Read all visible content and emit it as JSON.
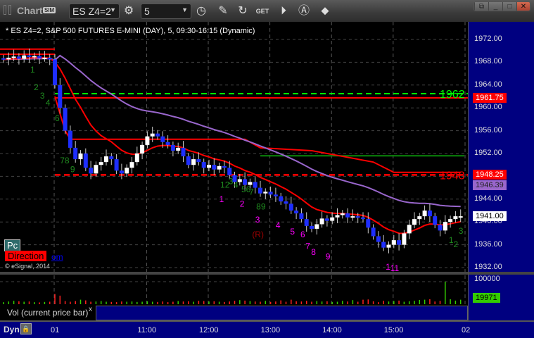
{
  "titlebar": {
    "title": "Chart",
    "sim_badge": "SIM",
    "symbol": "ES Z4=2",
    "interval": "5",
    "icons": [
      "settings-gear-icon",
      "clock-icon",
      "pencil-icon",
      "refresh-icon",
      "get-icon",
      "play-icon",
      "auto-scale-icon",
      "link-icon"
    ],
    "window_buttons": [
      "restore-dropdown",
      "minimize",
      "maximize",
      "close"
    ]
  },
  "chart_header": "* ES Z4=2, S&P 500 FUTURES E-MINI (DAY), 5, 09:30-16:15 (Dynamic)",
  "price_axis": {
    "ticks": [
      "1972.00",
      "1968.00",
      "1964.00",
      "1960.00",
      "1956.00",
      "1952.00",
      "1948.00",
      "1944.00",
      "1940.00",
      "1936.00",
      "1932.00"
    ],
    "tags": [
      {
        "text": "1961.75",
        "price": 1961.75,
        "bg": "#ff0000",
        "fg": "#ffffff"
      },
      {
        "text": "1948.25",
        "price": 1948.25,
        "bg": "#ff0000",
        "fg": "#ffffff"
      },
      {
        "text": "1946.39",
        "price": 1946.39,
        "bg": "#9966cc",
        "fg": "#222222"
      },
      {
        "text": "1941.00",
        "price": 1941.0,
        "bg": "#ffffff",
        "fg": "#000000"
      }
    ]
  },
  "levels": [
    {
      "label": "1962",
      "price": 1962.5,
      "color": "#00ff00",
      "dash": true
    },
    {
      "label": "1948",
      "price": 1948.25,
      "color": "#ff0000",
      "dash": true
    }
  ],
  "volume_axis": {
    "tick": "100000",
    "current": "19971",
    "label": "Vol (current price bar)",
    "close": "x"
  },
  "time_axis": {
    "mode": "Dyn",
    "ticks": [
      {
        "t": "01",
        "bar": 10
      },
      {
        "t": "11:00",
        "bar": 28
      },
      {
        "t": "12:00",
        "bar": 40
      },
      {
        "t": "13:00",
        "bar": 52
      },
      {
        "t": "14:00",
        "bar": 64
      },
      {
        "t": "15:00",
        "bar": 76
      },
      {
        "t": "02",
        "bar": 90
      }
    ]
  },
  "overlay": {
    "pc": "Pc",
    "direction": "Direction",
    "link": "om",
    "copyright": "© eSignal, 2014"
  },
  "chart_data": {
    "type": "candlestick",
    "ylim": [
      1932,
      1972
    ],
    "vol_max": 100000,
    "closes": [
      1968.5,
      1968.8,
      1969,
      1968.6,
      1969.2,
      1968.9,
      1969.1,
      1968.7,
      1968.8,
      1968.5,
      1964,
      1960,
      1956,
      1953,
      1951,
      1952,
      1949.5,
      1948.5,
      1950,
      1950.5,
      1951.5,
      1951,
      1949,
      1948.5,
      1949.5,
      1950.5,
      1952,
      1953.5,
      1955,
      1955.5,
      1955,
      1954,
      1953.5,
      1952.5,
      1953,
      1951.5,
      1950,
      1951,
      1950.5,
      1949.5,
      1950,
      1949.2,
      1949.8,
      1949.5,
      1948.2,
      1947,
      1947.5,
      1946.5,
      1947,
      1946,
      1945,
      1945.3,
      1944.8,
      1944.5,
      1943.6,
      1943.2,
      1942,
      1941.5,
      1940.5,
      1939.3,
      1938.8,
      1939.6,
      1940.6,
      1940.2,
      1940.8,
      1941.2,
      1941.5,
      1940.8,
      1941,
      1940.8,
      1940.5,
      1939,
      1937.5,
      1936.5,
      1935.5,
      1936,
      1936.8,
      1936,
      1938,
      1939.5,
      1940.5,
      1941,
      1942,
      1941,
      1939.5,
      1938.5,
      1940,
      1940.5,
      1941,
      1941
    ],
    "volumes": [
      9000,
      12000,
      15000,
      13000,
      11000,
      12000,
      9000,
      8000,
      10000,
      11000,
      45000,
      38000,
      14000,
      11000,
      14000,
      20000,
      17000,
      11000,
      12000,
      14000,
      11000,
      10000,
      9000,
      12000,
      11000,
      12000,
      10000,
      11000,
      13000,
      11000,
      10000,
      12000,
      9000,
      11000,
      14000,
      12000,
      13000,
      11000,
      15000,
      14000,
      12000,
      13000,
      11000,
      10000,
      12000,
      15000,
      18000,
      16000,
      14000,
      12000,
      11000,
      15000,
      10000,
      12000,
      17000,
      11000,
      20000,
      13000,
      12000,
      15000,
      11000,
      14000,
      12000,
      13000,
      10000,
      11000,
      15000,
      12000,
      18000,
      11000,
      20000,
      21000,
      13000,
      9000,
      15000,
      12000,
      14000,
      16000,
      11000,
      13000,
      15000,
      19000,
      20000,
      22000,
      12000,
      15000,
      100000,
      22000,
      16000,
      19971
    ],
    "annotations": [
      {
        "t": "1",
        "bar": 5.2,
        "p": 1966.2,
        "c": "#1f8a1f"
      },
      {
        "t": "2",
        "bar": 5.9,
        "p": 1963.1,
        "c": "#1f8a1f"
      },
      {
        "t": "3",
        "bar": 7.1,
        "p": 1961.6,
        "c": "#1f8a1f"
      },
      {
        "t": "4",
        "bar": 8.2,
        "p": 1960.4,
        "c": "#1f8a1f"
      },
      {
        "t": "6",
        "bar": 10,
        "p": 1957.7,
        "c": "#1f8a1f"
      },
      {
        "t": "7",
        "bar": 11,
        "p": 1950.3,
        "c": "#1f8a1f"
      },
      {
        "t": "8",
        "bar": 11.9,
        "p": 1950.3,
        "c": "#1f8a1f"
      },
      {
        "t": "9",
        "bar": 13,
        "p": 1948.7,
        "c": "#1f8a1f"
      },
      {
        "t": "12",
        "bar": 42.2,
        "p": 1946,
        "c": "#1f8a1f"
      },
      {
        "t": "3",
        "bar": 43.8,
        "p": 1946.6,
        "c": "#1f8a1f"
      },
      {
        "t": "4",
        "bar": 44.8,
        "p": 1946,
        "c": "#1f8a1f"
      },
      {
        "t": "56",
        "bar": 46.3,
        "p": 1945.2,
        "c": "#1f8a1f"
      },
      {
        "t": "7",
        "bar": 47.8,
        "p": 1944.8,
        "c": "#1f8a1f"
      },
      {
        "t": "89",
        "bar": 49.2,
        "p": 1942.2,
        "c": "#1f8a1f"
      },
      {
        "t": "1",
        "bar": 42,
        "p": 1943.5,
        "c": "#ff00ff"
      },
      {
        "t": "2",
        "bar": 46,
        "p": 1942.7,
        "c": "#ff00ff"
      },
      {
        "t": "3",
        "bar": 49,
        "p": 1939.9,
        "c": "#ff00ff"
      },
      {
        "t": "(R)",
        "bar": 48.4,
        "p": 1937.3,
        "c": "#a00000"
      },
      {
        "t": "4",
        "bar": 53,
        "p": 1938.9,
        "c": "#ff00ff"
      },
      {
        "t": "5",
        "bar": 55.8,
        "p": 1937.8,
        "c": "#ff00ff"
      },
      {
        "t": "6",
        "bar": 57.8,
        "p": 1937.3,
        "c": "#ff00ff"
      },
      {
        "t": "7",
        "bar": 58.8,
        "p": 1935.3,
        "c": "#ff00ff"
      },
      {
        "t": "8",
        "bar": 59.9,
        "p": 1934.2,
        "c": "#ff00ff"
      },
      {
        "t": "9",
        "bar": 62.7,
        "p": 1933.4,
        "c": "#ff00ff"
      },
      {
        "t": "1",
        "bar": 74.4,
        "p": 1931.6,
        "c": "#ff00ff"
      },
      {
        "t": "11",
        "bar": 75.3,
        "p": 1931.4,
        "c": "#ff00ff"
      },
      {
        "t": "1",
        "bar": 86.7,
        "p": 1936.3,
        "c": "#1f8a1f"
      },
      {
        "t": "2",
        "bar": 87.6,
        "p": 1935.6,
        "c": "#1f8a1f"
      },
      {
        "t": "3",
        "bar": 88.6,
        "p": 1937.9,
        "c": "#1f8a1f"
      }
    ]
  }
}
